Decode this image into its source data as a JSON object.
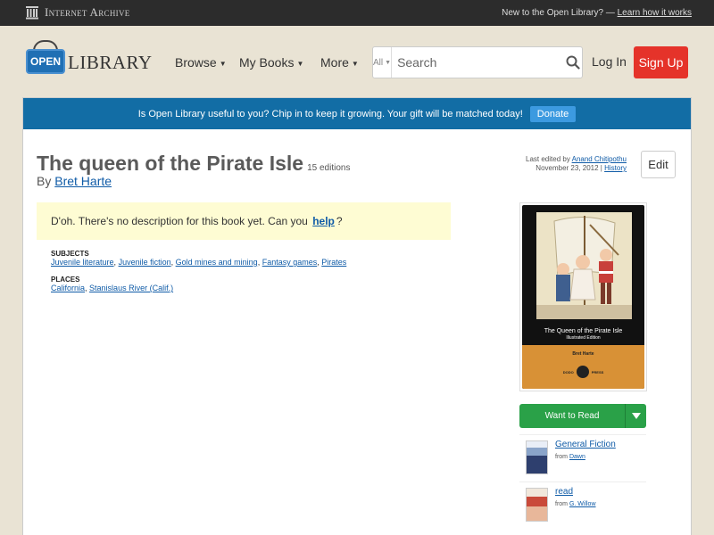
{
  "ia_bar": {
    "logo_text": "Internet Archive",
    "prompt": "New to the Open Library? —",
    "learn_link": "Learn how it works"
  },
  "header": {
    "logo_open": "OPEN",
    "logo_library": "LIBRARY",
    "nav": [
      "Browse",
      "My Books",
      "More"
    ],
    "search_scope": "All",
    "search_placeholder": "Search",
    "login": "Log In",
    "signup": "Sign Up"
  },
  "donate": {
    "message": "Is Open Library useful to you? Chip in to keep it growing. Your gift will be matched today!",
    "button": "Donate"
  },
  "book": {
    "title": "The queen of the Pirate Isle",
    "editions": "15 editions",
    "by": "By",
    "author": "Bret Harte",
    "last_edited_prefix": "Last edited by",
    "last_edited_user": "Anand Chitipothu",
    "last_edited_date": "November 23, 2012 |",
    "history": "History",
    "edit": "Edit",
    "desc_prefix": "D'oh. There's no description for this book yet. Can you",
    "desc_link": "help",
    "desc_suffix": "?",
    "subjects_heading": "SUBJECTS",
    "subjects": [
      "Juvenile literature",
      "Juvenile fiction",
      "Gold mines and mining",
      "Fantasy games",
      "Pirates"
    ],
    "places_heading": "PLACES",
    "places": [
      "California",
      "Stanislaus River (Calif.)"
    ]
  },
  "cover": {
    "title": "The Queen of the Pirate Isle",
    "subtitle": "Illustrated Edition",
    "author": "Bret Harte",
    "press_left": "DODO",
    "press_right": "PRESS"
  },
  "sidebar": {
    "want_to_read": "Want to Read",
    "lists": [
      {
        "name": "General Fiction",
        "from": "from",
        "owner": "Dawn"
      },
      {
        "name": "read",
        "from": "from",
        "owner": "G. Willow"
      }
    ]
  },
  "colors": {
    "accent_blue": "#126da5",
    "signup_red": "#e5332a",
    "want_green": "#2aa148"
  }
}
